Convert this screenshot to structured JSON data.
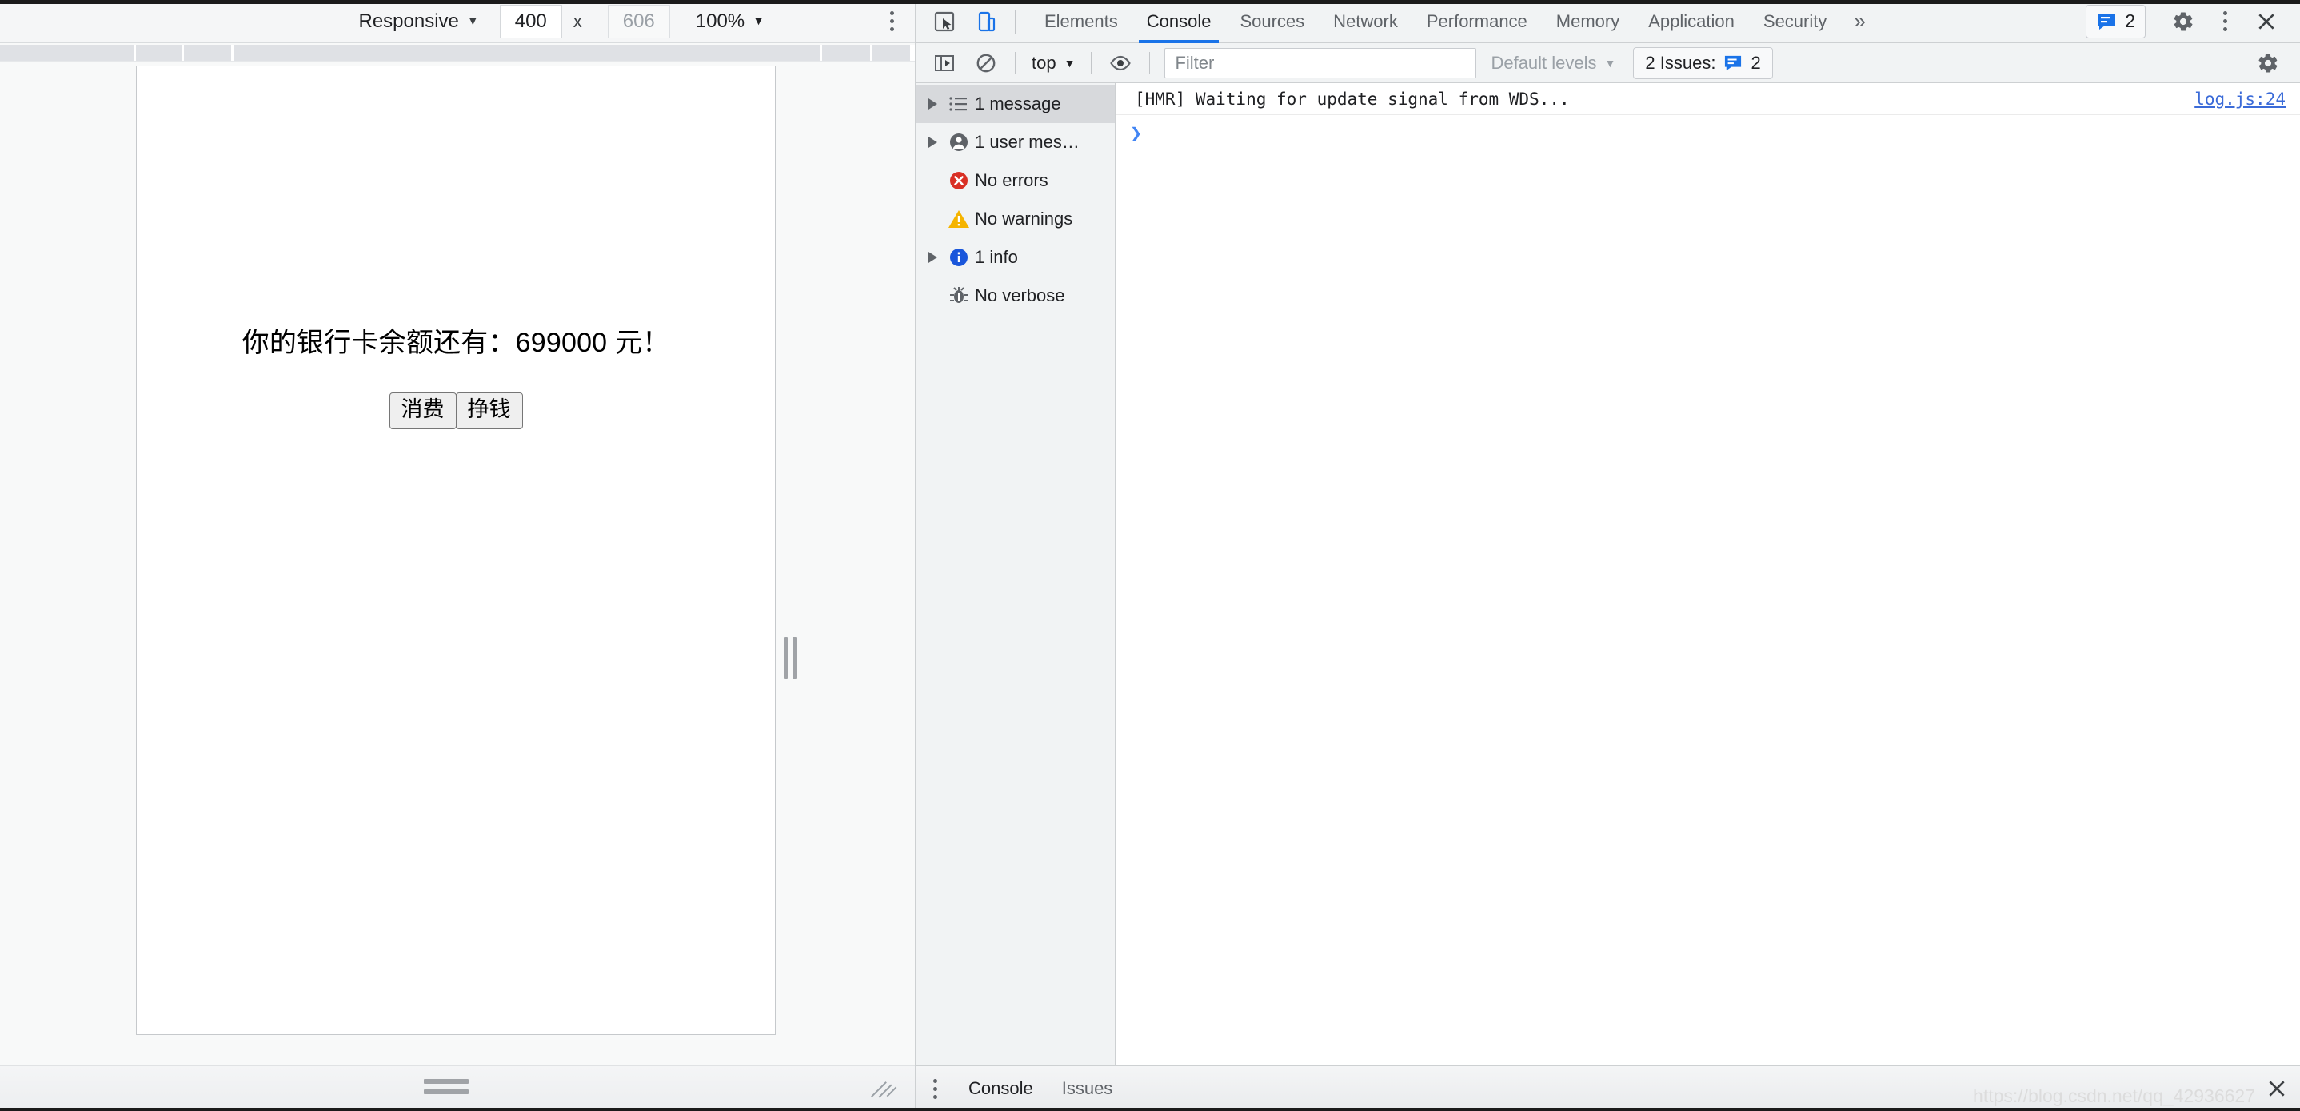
{
  "device_toolbar": {
    "device_label": "Responsive",
    "width_value": "400",
    "height_placeholder": "606",
    "multiply_symbol": "x",
    "zoom_label": "100%",
    "caret": "▼",
    "more_options_icon": "vertical-dots-icon"
  },
  "devtools": {
    "inspect_icon": "inspect-element-icon",
    "device_toggle_icon": "device-toolbar-icon",
    "tabs": [
      {
        "label": "Elements",
        "active": false
      },
      {
        "label": "Console",
        "active": true
      },
      {
        "label": "Sources",
        "active": false
      },
      {
        "label": "Network",
        "active": false
      },
      {
        "label": "Performance",
        "active": false
      },
      {
        "label": "Memory",
        "active": false
      },
      {
        "label": "Application",
        "active": false
      },
      {
        "label": "Security",
        "active": false
      }
    ],
    "more_tabs_label": "»",
    "issues_badge_count": "2",
    "issues_badge_icon": "issues-icon",
    "settings_icon": "gear-icon",
    "main_menu_icon": "vertical-dots-icon",
    "close_icon": "close-icon"
  },
  "console_toolbar": {
    "sidebar_toggle_icon": "show-console-sidebar-icon",
    "clear_icon": "clear-console-icon",
    "context_label": "top",
    "context_caret": "▼",
    "live_expression_icon": "eye-icon",
    "filter_placeholder": "Filter",
    "filter_value": "",
    "levels_label": "Default levels",
    "levels_caret": "▼",
    "issues_label": "2 Issues:",
    "issues_count": "2",
    "issues_icon": "issues-icon",
    "settings_icon": "gear-icon"
  },
  "console_sidebar": {
    "items": [
      {
        "label": "1 message",
        "icon": "list-icon",
        "expandable": true,
        "selected": true
      },
      {
        "label": "1 user mes…",
        "icon": "user-icon",
        "expandable": true,
        "selected": false
      },
      {
        "label": "No errors",
        "icon": "error-icon",
        "expandable": false,
        "selected": false
      },
      {
        "label": "No warnings",
        "icon": "warning-icon",
        "expandable": false,
        "selected": false
      },
      {
        "label": "1 info",
        "icon": "info-icon",
        "expandable": true,
        "selected": false
      },
      {
        "label": "No verbose",
        "icon": "bug-icon",
        "expandable": false,
        "selected": false
      }
    ]
  },
  "console_messages": [
    {
      "text": "[HMR] Waiting for update signal from WDS...",
      "source": "log.js:24"
    }
  ],
  "console_prompt": {
    "caret": "❯"
  },
  "drawer": {
    "more_icon": "vertical-dots-icon",
    "tabs": [
      {
        "label": "Console",
        "active": true
      },
      {
        "label": "Issues",
        "active": false
      }
    ],
    "close_icon": "close-icon"
  },
  "page_content": {
    "balance_text": "你的银行卡余额还有：699000 元！",
    "buttons": [
      {
        "label": "消费"
      },
      {
        "label": "挣钱"
      }
    ]
  },
  "watermark": "https://blog.csdn.net/qq_42936627",
  "colors": {
    "accent": "#1a73e8",
    "error": "#d93025",
    "warning": "#f5b400",
    "info": "#1a56db",
    "toolbar_bg": "#f1f3f4"
  }
}
